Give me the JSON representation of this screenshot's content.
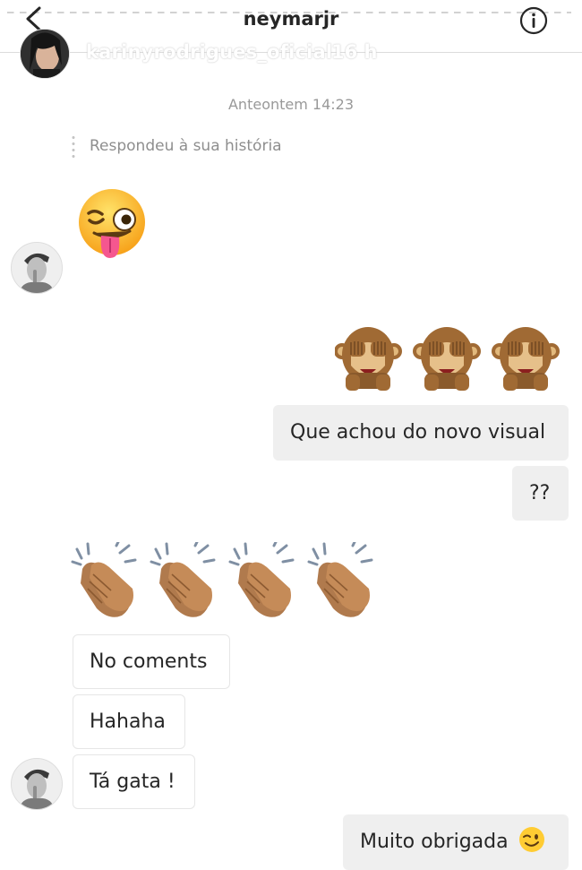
{
  "header": {
    "title": "neymarjr",
    "back_icon": "chevron-left-icon",
    "info_icon": "info-icon"
  },
  "story": {
    "username": "karinyrodrigues_oficial",
    "time": "16 h"
  },
  "thread": {
    "timestamp": "Anteontem 14:23",
    "reply_label": "Respondeu à sua história",
    "messages": [
      {
        "direction": "incoming",
        "type": "emoji",
        "content": "winking face with tongue"
      },
      {
        "direction": "outgoing",
        "type": "emoji",
        "content": "see-no-evil monkey x3"
      },
      {
        "direction": "outgoing",
        "type": "text",
        "text": "Que achou do novo visual"
      },
      {
        "direction": "outgoing",
        "type": "text",
        "text": "??"
      },
      {
        "direction": "incoming",
        "type": "emoji",
        "content": "clapping hands x4"
      },
      {
        "direction": "incoming",
        "type": "text",
        "text": "No coments"
      },
      {
        "direction": "incoming",
        "type": "text",
        "text": "Hahaha"
      },
      {
        "direction": "incoming",
        "type": "text",
        "text": "Tá gata !"
      },
      {
        "direction": "outgoing",
        "type": "text",
        "text": "Muito obrigada",
        "trailing_emoji": "winking face"
      }
    ]
  },
  "colors": {
    "outgoing_bubble": "#efefef",
    "incoming_border": "#e6e6e6",
    "muted_text": "#999999",
    "primary_text": "#262626"
  }
}
